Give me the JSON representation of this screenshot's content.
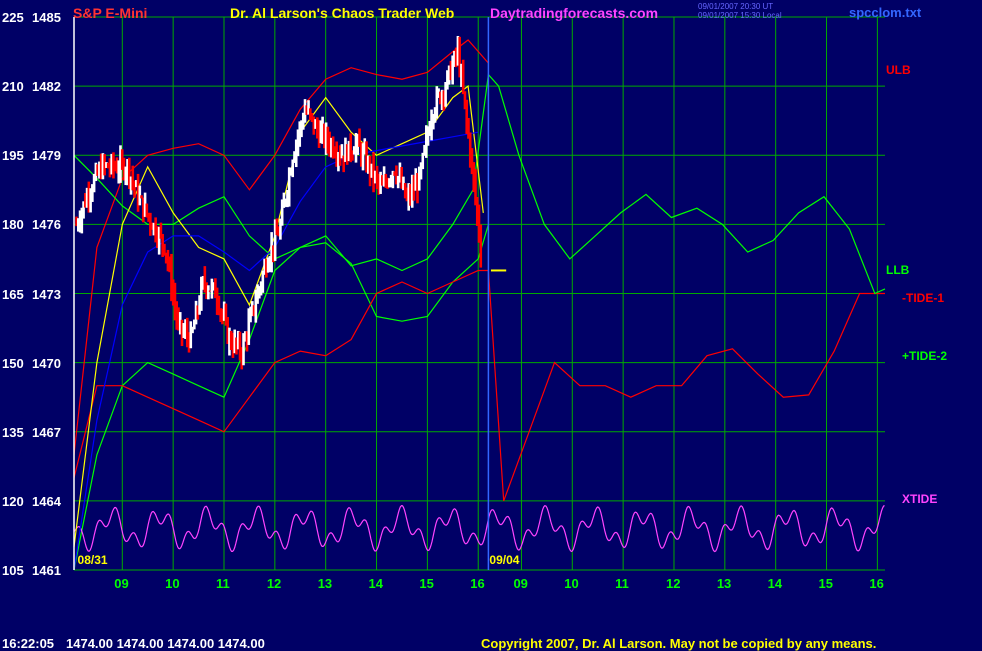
{
  "header": {
    "instrument": "S&P E-Mini",
    "site_title": "Dr. Al Larson's Chaos Trader Web",
    "site_url": "Daytradingforecasts.com",
    "timestamp_1": "09/01/2007 20:30 UT",
    "timestamp_2": "09/01/2007 15:30 Local",
    "file_name": "spcclom.txt"
  },
  "footer": {
    "time": "16:22:05",
    "ohlc": "1474.00 1474.00 1474.00 1474.00",
    "copyright": "Copyright 2007, Dr. Al Larson. May not be copied by any means."
  },
  "colors": {
    "background": "#000066",
    "grid": "#00aa00",
    "price_up": "#ffffff",
    "price_down": "#ff0000",
    "ulb": "#ff0000",
    "llb": "#00ff00",
    "tide1": "#ff0000",
    "tide2": "#00ff00",
    "xtide": "#ff44ff",
    "ma_yellow": "#ffff00",
    "ma_blue": "#0000ff"
  },
  "chart_data": {
    "type": "line",
    "y_labels": [
      {
        "left": "225",
        "right": "1485",
        "value": 1485
      },
      {
        "left": "210",
        "right": "1482",
        "value": 1482
      },
      {
        "left": "195",
        "right": "1479",
        "value": 1479
      },
      {
        "left": "180",
        "right": "1476",
        "value": 1476
      },
      {
        "left": "165",
        "right": "1473",
        "value": 1473
      },
      {
        "left": "150",
        "right": "1470",
        "value": 1470
      },
      {
        "left": "135",
        "right": "1467",
        "value": 1467
      },
      {
        "left": "120",
        "right": "1464",
        "value": 1464
      },
      {
        "left": "105",
        "right": "1461",
        "value": 1461
      }
    ],
    "ylim": [
      1461,
      1485
    ],
    "xlim": [
      8.0,
      16.35
    ],
    "x_ticks": [
      {
        "label": "09",
        "x": 9
      },
      {
        "label": "10",
        "x": 10
      },
      {
        "label": "11",
        "x": 11
      },
      {
        "label": "12",
        "x": 12
      },
      {
        "label": "13",
        "x": 13
      },
      {
        "label": "14",
        "x": 14
      },
      {
        "label": "15",
        "x": 15
      },
      {
        "label": "16",
        "x": 16
      },
      {
        "label": "09",
        "x": 16.85
      },
      {
        "label": "10",
        "x": 17.85
      },
      {
        "label": "11",
        "x": 18.85
      },
      {
        "label": "12",
        "x": 19.85
      },
      {
        "label": "13",
        "x": 20.85
      },
      {
        "label": "14",
        "x": 21.85
      },
      {
        "label": "15",
        "x": 22.85
      },
      {
        "label": "16",
        "x": 23.85
      }
    ],
    "x_range": [
      8.05,
      24.0
    ],
    "date_labels": [
      {
        "label": "08/31",
        "x": 8.1
      },
      {
        "label": "09/04",
        "x": 16.2
      }
    ],
    "series_labels": [
      {
        "label": "ULB",
        "value": 1482.7
      },
      {
        "label": "LLB",
        "value": 1474.0
      },
      {
        "label": "-TIDE-1",
        "value": 1472.8
      },
      {
        "label": "+TIDE-2",
        "value": 1470.3
      },
      {
        "label": "XTIDE",
        "value": 1464.1
      }
    ],
    "grid": true,
    "last_price": 1474.0,
    "series": [
      {
        "name": "ULB",
        "color": "#ff0000",
        "x": [
          8.05,
          8.5,
          9,
          9.5,
          10,
          10.5,
          11,
          11.5,
          12,
          12.5,
          13,
          13.5,
          14,
          14.5,
          15,
          15.5,
          15.8,
          16.2
        ],
        "values": [
          1466,
          1475,
          1478,
          1479,
          1479.3,
          1479.5,
          1479,
          1477.5,
          1479,
          1481,
          1482.3,
          1482.8,
          1482.5,
          1482.3,
          1482.6,
          1483.5,
          1484,
          1483
        ]
      },
      {
        "name": "LLB",
        "color": "#00ff00",
        "x": [
          8.05,
          8.5,
          9,
          9.5,
          10,
          10.5,
          11,
          11.5,
          12,
          12.5,
          13,
          13.5,
          14,
          14.5,
          15,
          15.5,
          16,
          16.2
        ],
        "values": [
          1461,
          1466,
          1469,
          1470,
          1469.5,
          1469,
          1468.5,
          1471,
          1474,
          1475,
          1475.2,
          1474.3,
          1472,
          1471.8,
          1472,
          1473.5,
          1474.5,
          1476
        ]
      },
      {
        "name": "-TIDE-1",
        "color": "#ff0000",
        "x": [
          8.05,
          8.5,
          9,
          9.5,
          10,
          10.5,
          11,
          11.5,
          12,
          12.5,
          13,
          13.5,
          14,
          14.5,
          15,
          15.5,
          16,
          16.2,
          16.5,
          17,
          17.5,
          18,
          18.5,
          19,
          19.5,
          20,
          20.5,
          21,
          21.5,
          22,
          22.5,
          23,
          23.5,
          24
        ],
        "values": [
          1465,
          1469,
          1469,
          1468.5,
          1468,
          1467.5,
          1467,
          1468.5,
          1470,
          1470.5,
          1470.3,
          1471,
          1473,
          1473.5,
          1473,
          1473.5,
          1474,
          1474,
          1464,
          1467,
          1470,
          1469,
          1469,
          1468.5,
          1469,
          1469,
          1470.3,
          1470.6,
          1469.5,
          1468.5,
          1468.6,
          1470.5,
          1473,
          1473
        ]
      },
      {
        "name": "+TIDE-2",
        "color": "#00ff00",
        "x": [
          8.05,
          8.5,
          9,
          9.5,
          10,
          10.5,
          11,
          11.5,
          12,
          12.5,
          13,
          13.5,
          14,
          14.5,
          15,
          15.5,
          15.9,
          16.2,
          16.4,
          16.8,
          17.3,
          17.8,
          18.3,
          18.8,
          19.3,
          19.8,
          20.3,
          20.8,
          21.3,
          21.8,
          22.3,
          22.8,
          23.3,
          23.8,
          24
        ],
        "values": [
          1479,
          1478,
          1476.8,
          1476,
          1476,
          1476.7,
          1477.2,
          1475.5,
          1474.5,
          1475,
          1475.5,
          1474.2,
          1474.5,
          1474,
          1474.5,
          1476,
          1477.5,
          1482.5,
          1482,
          1479,
          1476,
          1474.5,
          1475.5,
          1476.5,
          1477.3,
          1476.3,
          1476.7,
          1476,
          1474.8,
          1475.3,
          1476.5,
          1477.2,
          1475.8,
          1473,
          1473.2
        ]
      },
      {
        "name": "XTIDE",
        "color": "#ff44ff",
        "kind": "oscillator",
        "x_start": 8.05,
        "x_end": 24.0,
        "base": 1462.8,
        "amplitude": 1.0,
        "period": 0.95
      },
      {
        "name": "moving-average-yellow",
        "color": "#ffff00",
        "x": [
          8.05,
          8.5,
          9,
          9.5,
          10,
          10.5,
          11,
          11.5,
          12,
          12.5,
          13,
          13.5,
          14,
          14.5,
          15,
          15.5,
          15.8,
          16.1
        ],
        "values": [
          1462,
          1470,
          1476,
          1478.5,
          1476.5,
          1475,
          1474.5,
          1472.5,
          1475.5,
          1480,
          1481.5,
          1480,
          1479,
          1479.5,
          1480,
          1481.5,
          1482,
          1476.5
        ]
      },
      {
        "name": "moving-average-blue",
        "color": "#0000ff",
        "x": [
          8.05,
          8.5,
          9,
          9.5,
          10,
          10.5,
          11,
          11.5,
          12,
          12.5,
          13,
          13.5,
          14,
          14.5,
          15,
          15.5,
          16
        ],
        "values": [
          1461,
          1467.5,
          1472.5,
          1474.8,
          1475.5,
          1475.5,
          1474.8,
          1474,
          1475,
          1477,
          1478.5,
          1479,
          1479.2,
          1479.4,
          1479.6,
          1479.8,
          1480
        ]
      },
      {
        "name": "price",
        "kind": "bars",
        "x": [
          8.1,
          8.35,
          8.6,
          8.85,
          9.1,
          9.35,
          9.6,
          9.85,
          10.1,
          10.35,
          10.6,
          10.85,
          11.1,
          11.35,
          11.6,
          11.85,
          12.1,
          12.35,
          12.6,
          12.85,
          13.1,
          13.35,
          13.6,
          13.85,
          14.1,
          14.35,
          14.6,
          14.85,
          15.1,
          15.35,
          15.6,
          15.85,
          16.05
        ],
        "values": [
          1476,
          1477.5,
          1478.5,
          1478.5,
          1478.5,
          1477,
          1476,
          1475,
          1471.5,
          1471,
          1473.5,
          1473,
          1471,
          1470.5,
          1472.5,
          1474.5,
          1475.8,
          1479,
          1481,
          1480,
          1479.5,
          1479,
          1479.5,
          1478.5,
          1477.5,
          1478.5,
          1477,
          1478,
          1481,
          1482,
          1483.5,
          1479,
          1475
        ]
      }
    ]
  }
}
